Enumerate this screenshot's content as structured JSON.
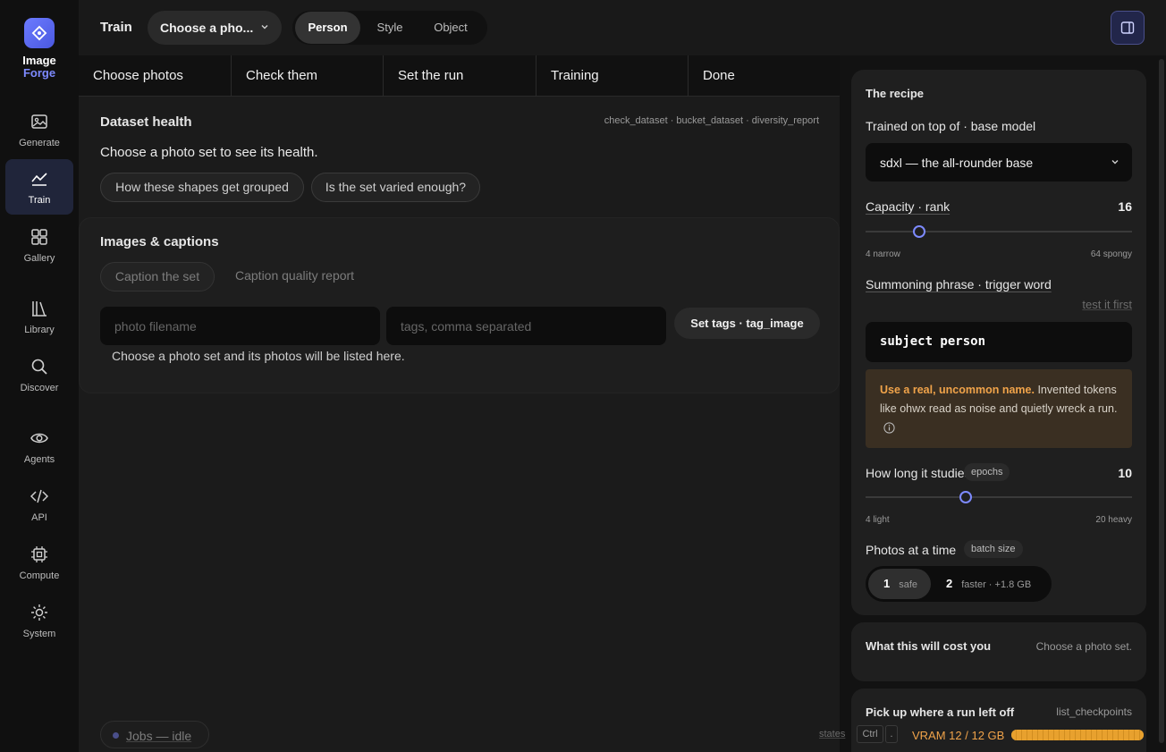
{
  "brand": {
    "line1": "Image",
    "line2": "Forge"
  },
  "nav": [
    {
      "label": "Generate",
      "icon": "image-icon",
      "active": false
    },
    {
      "label": "Train",
      "icon": "chart-line-icon",
      "active": true
    },
    {
      "label": "Gallery",
      "icon": "grid-icon",
      "active": false
    },
    {
      "label": "Library",
      "icon": "library-icon",
      "active": false
    },
    {
      "label": "Discover",
      "icon": "search-icon",
      "active": false
    },
    {
      "label": "Agents",
      "icon": "eye-icon",
      "active": false
    },
    {
      "label": "API",
      "icon": "code-icon",
      "active": false
    },
    {
      "label": "Compute",
      "icon": "chip-icon",
      "active": false
    },
    {
      "label": "System",
      "icon": "sun-gear-icon",
      "active": false
    }
  ],
  "header": {
    "title": "Train",
    "set_select": "Choose a pho...",
    "modes": [
      "Person",
      "Style",
      "Object"
    ],
    "active_mode": "Person"
  },
  "steps": [
    "Choose photos",
    "Check them",
    "Set the run",
    "Training",
    "Done"
  ],
  "health": {
    "title": "Dataset health",
    "tools": "check_dataset · bucket_dataset · diversity_report",
    "message": "Choose a photo set to see its health.",
    "buttons": [
      "How these shapes get grouped",
      "Is the set varied enough?"
    ]
  },
  "images": {
    "title": "Images & captions",
    "caption_btn": "Caption the set",
    "quality_btn": "Caption quality report",
    "filename_placeholder": "photo filename",
    "tags_placeholder": "tags, comma separated",
    "set_tags_btn": "Set tags  · tag_image",
    "message": "Choose a photo set and its photos will be listed here."
  },
  "jobs": {
    "label": "Jobs — idle"
  },
  "recipe": {
    "title": "The recipe",
    "base_label": "Trained on top of · base model",
    "base_value": "sdxl — the all-rounder base",
    "rank_label": "Capacity · rank",
    "rank_value": "16",
    "rank_fraction": 0.2,
    "rank_min_label": "4 narrow",
    "rank_max_label": "64 spongy",
    "trigger_label": "Summoning phrase · trigger word",
    "test_link": "test it first",
    "trigger_value": "subject person",
    "warning_bold": "Use a real, uncommon name.",
    "warning_text": " Invented tokens like ohwx read as noise and quietly wreck a run.",
    "epochs_label": "How long it studies",
    "epochs_chip": "epochs",
    "epochs_value": "10",
    "epochs_fraction": 0.375,
    "epochs_min_label": "4 light",
    "epochs_max_label": "20 heavy",
    "batch_label": "Photos at a time",
    "batch_chip": "batch size",
    "batch_options": [
      {
        "num": "1",
        "sub": "safe",
        "active": true
      },
      {
        "num": "2",
        "sub": "faster · +1.8 GB",
        "active": false
      }
    ]
  },
  "cost": {
    "title": "What this will cost you",
    "hint": "Choose a photo set."
  },
  "resume": {
    "title": "Pick up where a run left off",
    "hint": "list_checkpoints"
  },
  "status": {
    "states_label": "states",
    "kbd1": "Ctrl",
    "kbd2": ".",
    "vram_label": "VRAM 12 / 12 GB",
    "vram_fraction": 1.0,
    "accent": "#7d8aff",
    "warn_color": "#f0a34a"
  }
}
